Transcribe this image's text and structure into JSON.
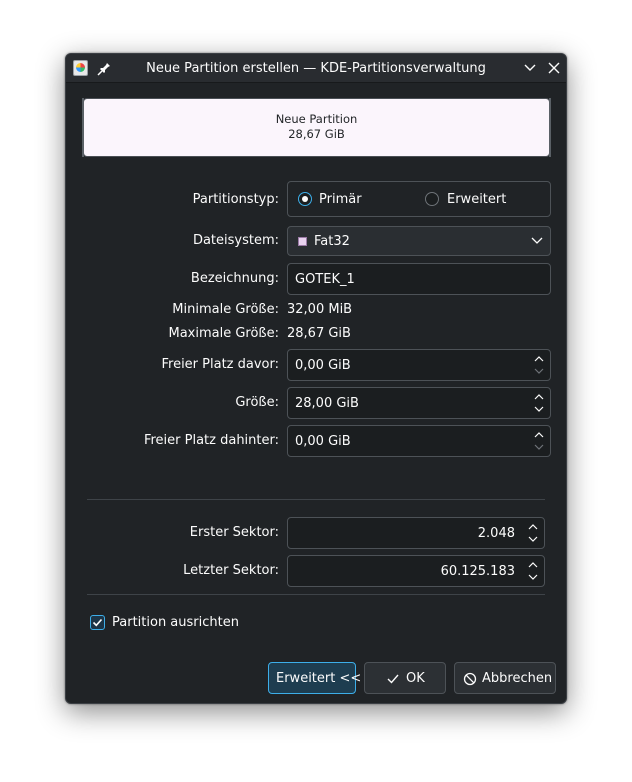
{
  "window": {
    "title": "Neue Partition erstellen — KDE-Partitionsverwaltung",
    "icons": [
      "partitionmanager-app-icon",
      "pin-icon",
      "minimize-chevron-icon",
      "close-icon"
    ]
  },
  "preview": {
    "name": "Neue Partition",
    "size": "28,67 GiB",
    "fill_color": "#fbf5fc"
  },
  "form": {
    "partition_type": {
      "label": "Partitionstyp:",
      "options": [
        "Primär",
        "Erweitert"
      ],
      "selected": "Primär"
    },
    "filesystem": {
      "label": "Dateisystem:",
      "value": "Fat32",
      "swatch_color": "#e8d2ef"
    },
    "label_field": {
      "label": "Bezeichnung:",
      "value": "GOTEK_1"
    },
    "min_size": {
      "label": "Minimale Größe:",
      "value": "32,00 MiB"
    },
    "max_size": {
      "label": "Maximale Größe:",
      "value": "28,67 GiB"
    },
    "free_before": {
      "label": "Freier Platz davor:",
      "value": "0,00 GiB"
    },
    "size": {
      "label": "Größe:",
      "value": "28,00 GiB"
    },
    "free_after": {
      "label": "Freier Platz dahinter:",
      "value": "0,00 GiB"
    },
    "first_sector": {
      "label": "Erster Sektor:",
      "value": "2.048"
    },
    "last_sector": {
      "label": "Letzter Sektor:",
      "value": "60.125.183"
    },
    "align": {
      "label": "Partition ausrichten",
      "checked": true
    }
  },
  "buttons": {
    "advanced": "Erweitert <<",
    "ok": "OK",
    "cancel": "Abbrechen"
  },
  "colors": {
    "accent": "#3daee9",
    "window_bg": "#202326",
    "field_bg": "#1b1e20"
  }
}
